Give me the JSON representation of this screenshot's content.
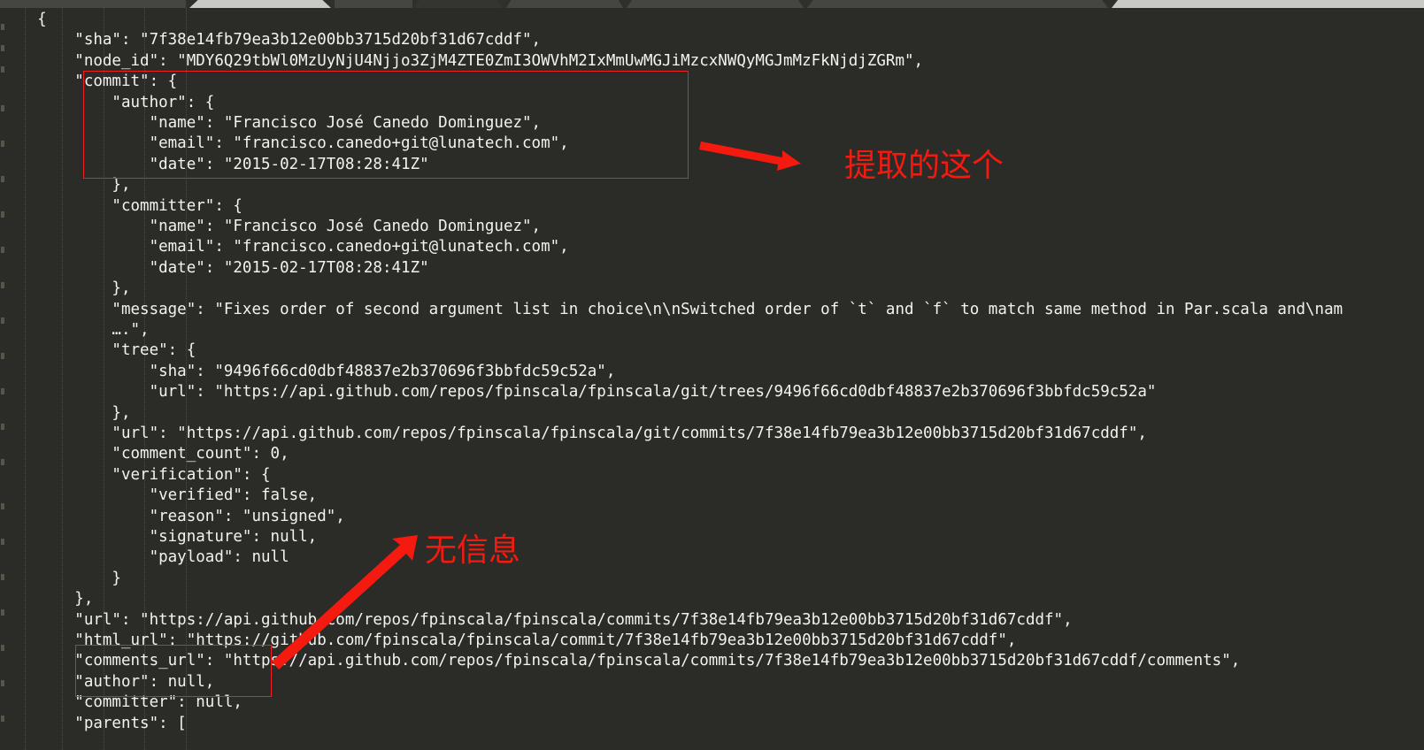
{
  "window": {
    "background_color": "#2b2b28",
    "text_color": "#f2f2ee",
    "annotation_color": "#f41a10",
    "tabstrip_colors": [
      "#454541",
      "#c9c9c6",
      "#454541",
      "#35352f",
      "#454541",
      "#454541",
      "#454541",
      "#c9c9c6"
    ]
  },
  "code": {
    "language": "json",
    "lines": [
      "    {",
      "        \"sha\": \"7f38e14fb79ea3b12e00bb3715d20bf31d67cddf\",",
      "        \"node_id\": \"MDY6Q29tbWl0MzUyNjU4Njjo3ZjM4ZTE0ZmI3OWVhM2IxMmUwMGJiMzcxNWQyMGJmMzFkNjdjZGRm\",",
      "        \"commit\": {",
      "            \"author\": {",
      "                \"name\": \"Francisco José Canedo Dominguez\",",
      "                \"email\": \"francisco.canedo+git@lunatech.com\",",
      "                \"date\": \"2015-02-17T08:28:41Z\"",
      "            },",
      "            \"committer\": {",
      "                \"name\": \"Francisco José Canedo Dominguez\",",
      "                \"email\": \"francisco.canedo+git@lunatech.com\",",
      "                \"date\": \"2015-02-17T08:28:41Z\"",
      "            },",
      "            \"message\": \"Fixes order of second argument list in choice\\n\\nSwitched order of `t` and `f` to match same method in Par.scala and\\nam",
      "            ….\",",
      "            \"tree\": {",
      "                \"sha\": \"9496f66cd0dbf48837e2b370696f3bbfdc59c52a\",",
      "                \"url\": \"https://api.github.com/repos/fpinscala/fpinscala/git/trees/9496f66cd0dbf48837e2b370696f3bbfdc59c52a\"",
      "            },",
      "            \"url\": \"https://api.github.com/repos/fpinscala/fpinscala/git/commits/7f38e14fb79ea3b12e00bb3715d20bf31d67cddf\",",
      "            \"comment_count\": 0,",
      "            \"verification\": {",
      "                \"verified\": false,",
      "                \"reason\": \"unsigned\",",
      "                \"signature\": null,",
      "                \"payload\": null",
      "            }",
      "        },",
      "        \"url\": \"https://api.github.com/repos/fpinscala/fpinscala/commits/7f38e14fb79ea3b12e00bb3715d20bf31d67cddf\",",
      "        \"html_url\": \"https://github.com/fpinscala/fpinscala/commit/7f38e14fb79ea3b12e00bb3715d20bf31d67cddf\",",
      "        \"comments_url\": \"https://api.github.com/repos/fpinscala/fpinscala/commits/7f38e14fb79ea3b12e00bb3715d20bf31d67cddf/comments\",",
      "        \"author\": null,",
      "        \"committer\": null,",
      "        \"parents\": ["
    ]
  },
  "annotations": {
    "author_label": "提取的这个",
    "verification_label": "无信息"
  }
}
